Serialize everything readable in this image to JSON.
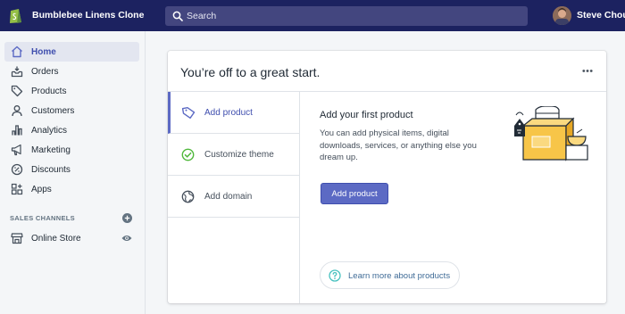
{
  "topbar": {
    "store_name": "Bumblebee Linens Clone",
    "search_placeholder": "Search",
    "user_name": "Steve Chou"
  },
  "sidebar": {
    "items": [
      {
        "label": "Home",
        "icon": "home-icon",
        "active": true
      },
      {
        "label": "Orders",
        "icon": "orders-icon"
      },
      {
        "label": "Products",
        "icon": "tag-icon"
      },
      {
        "label": "Customers",
        "icon": "person-icon"
      },
      {
        "label": "Analytics",
        "icon": "bar-chart-icon"
      },
      {
        "label": "Marketing",
        "icon": "megaphone-icon"
      },
      {
        "label": "Discounts",
        "icon": "discount-icon"
      },
      {
        "label": "Apps",
        "icon": "apps-icon"
      }
    ],
    "sales_channels_title": "SALES CHANNELS",
    "channels": [
      {
        "label": "Online Store",
        "icon": "store-icon"
      }
    ]
  },
  "card": {
    "title": "You’re off to a great start.",
    "tabs": [
      {
        "label": "Add product",
        "icon": "tag-icon",
        "active": true
      },
      {
        "label": "Customize theme",
        "icon": "check-circle-icon"
      },
      {
        "label": "Add domain",
        "icon": "globe-icon"
      }
    ],
    "panel": {
      "title": "Add your first product",
      "description": "You can add physical items, digital downloads, services, or anything else you dream up.",
      "button_label": "Add product",
      "learn_more_label": "Learn more about products"
    }
  },
  "colors": {
    "topbar": "#1c2260",
    "accent": "#5c6ac4",
    "active_text": "#3f4eae"
  }
}
